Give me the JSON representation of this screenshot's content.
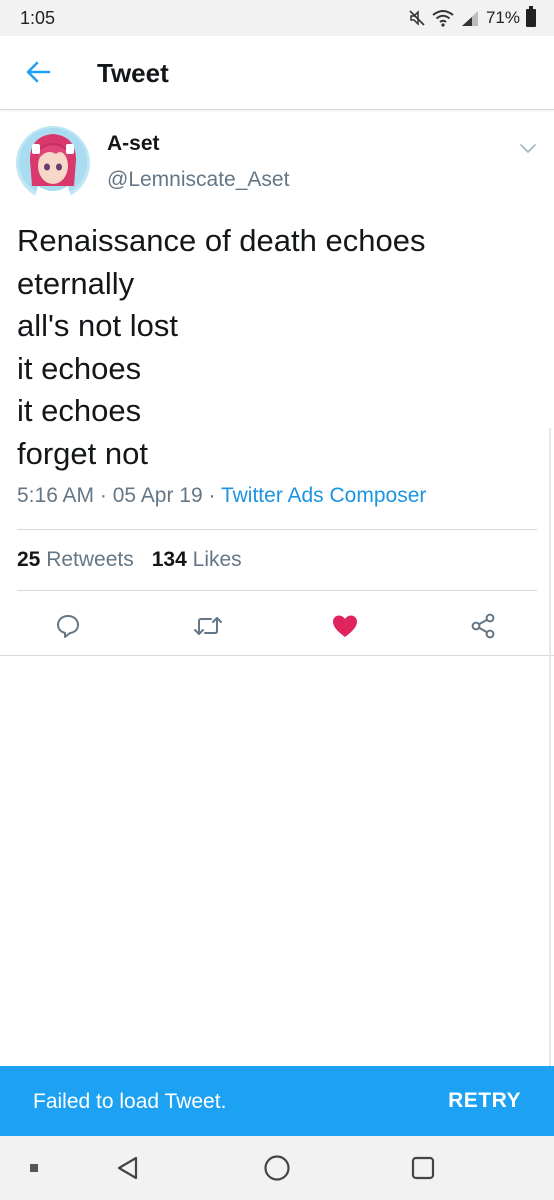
{
  "status_bar": {
    "time": "1:05",
    "battery": "71%",
    "icons": [
      "mute-icon",
      "wifi-icon",
      "signal-icon",
      "battery-icon"
    ]
  },
  "header": {
    "back_icon": "arrow-left-icon",
    "title": "Tweet"
  },
  "tweet": {
    "author_name": "A-set",
    "author_handle": "@Lemniscate_Aset",
    "text_lines": [
      "Renaissance of death echoes",
      "eternally",
      "all's not lost",
      "it echoes",
      "it echoes",
      "forget not"
    ],
    "time": "5:16 AM",
    "date": "05 Apr 19",
    "separator": "·",
    "source": "Twitter Ads Composer",
    "retweets_count": "25",
    "retweets_label": "Retweets",
    "likes_count": "134",
    "likes_label": "Likes",
    "liked": true
  },
  "actions": [
    "reply-icon",
    "retweet-icon",
    "heart-icon",
    "share-icon"
  ],
  "snackbar": {
    "message": "Failed to load Tweet.",
    "action": "RETRY"
  },
  "colors": {
    "accent": "#1da1f2",
    "link": "#1b95e0",
    "like": "#e0245e",
    "secondary_text": "#657786"
  }
}
